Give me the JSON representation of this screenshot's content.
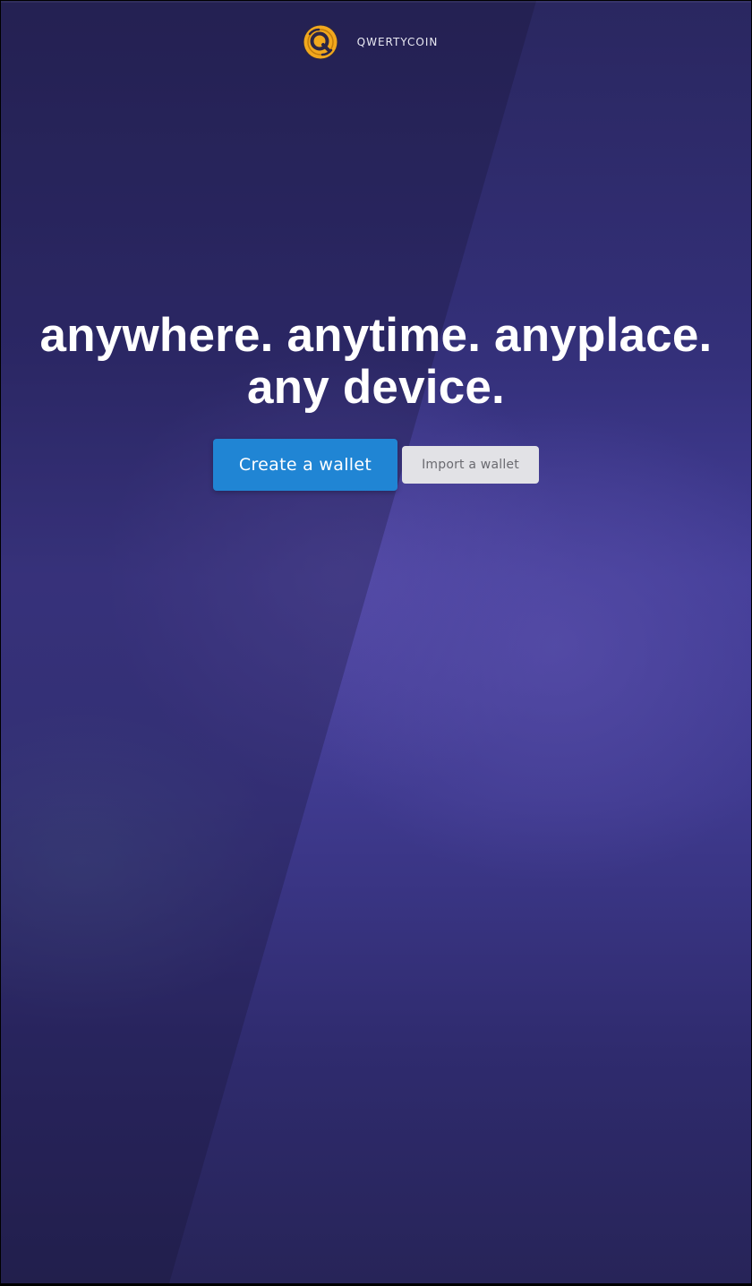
{
  "header": {
    "brand_name": "QWERTYCOIN",
    "logo_icon": "qwertycoin-logo-icon",
    "logo_color": "#f2a81d"
  },
  "hero": {
    "headline_line1": "anywhere. anytime. anyplace.",
    "headline_line2": "any device."
  },
  "actions": {
    "create_label": "Create a wallet",
    "import_label": "Import a wallet"
  },
  "colors": {
    "primary_button": "#2085d4",
    "secondary_button": "#e2e2e6",
    "background": "#3a3585"
  }
}
